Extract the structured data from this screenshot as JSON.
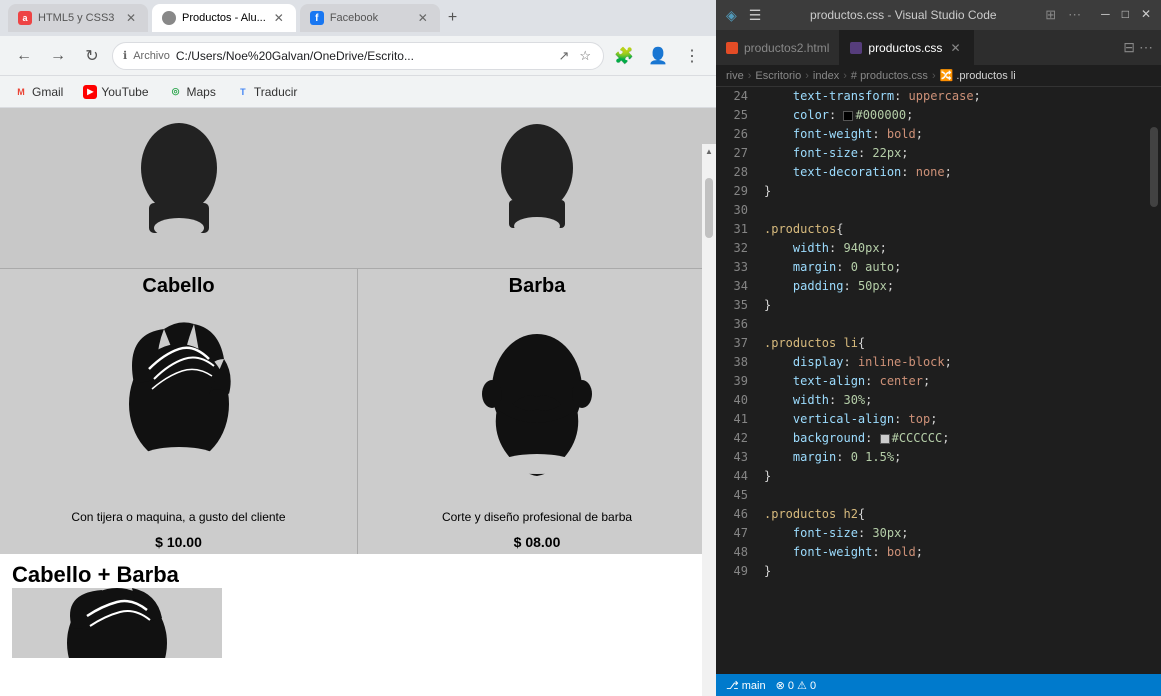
{
  "browser": {
    "tabs": [
      {
        "id": "tab-html5",
        "label": "HTML5 y CSS3",
        "icon_type": "a",
        "active": false
      },
      {
        "id": "tab-productos",
        "label": "Productos - Alu...",
        "icon_type": "prod",
        "active": true
      },
      {
        "id": "tab-facebook",
        "label": "Facebook",
        "icon_type": "fb",
        "active": false
      }
    ],
    "tab_add_label": "+",
    "nav": {
      "back": "←",
      "forward": "→",
      "refresh": "↻",
      "home": "⌂"
    },
    "address": {
      "protocol": "Archivo",
      "path": "C:/Users/Noe%20Galvan/OneDrive/Escrito..."
    },
    "address_icons": [
      "⭐",
      "🧩",
      "⊕"
    ],
    "bookmarks": [
      {
        "id": "gmail",
        "label": "Gmail",
        "icon": "M"
      },
      {
        "id": "youtube",
        "label": "YouTube",
        "icon": "▶"
      },
      {
        "id": "maps",
        "label": "Maps",
        "icon": "◉"
      },
      {
        "id": "traducir",
        "label": "Traducir",
        "icon": "T"
      }
    ]
  },
  "products_page": {
    "top_images": {
      "left": "silhouette_head_1",
      "right": "silhouette_head_2"
    },
    "products": [
      {
        "id": "cabello",
        "title": "Cabello",
        "description": "Con tijera o maquina, a gusto del cliente",
        "price": "$ 10.00"
      },
      {
        "id": "barba",
        "title": "Barba",
        "description": "Corte y diseño profesional de barba",
        "price": "$ 08.00"
      }
    ],
    "combo_title": "Cabello + Barba"
  },
  "vscode": {
    "titlebar": {
      "menu_icon": "☰",
      "split_icon": "⊞",
      "more_icon": "⋯",
      "title": "productos.css - Visual Studio Code",
      "btn_minimize": "─",
      "btn_maximize": "□",
      "btn_close": "✕"
    },
    "tabs": [
      {
        "id": "productos2-html",
        "label": "productos2.html",
        "icon_type": "html",
        "active": false
      },
      {
        "id": "productos-css",
        "label": "productos.css",
        "icon_type": "css",
        "active": true
      }
    ],
    "breadcrumb": {
      "parts": [
        "rive",
        "Escritorio",
        "index",
        "#  productos.css",
        "🔀 .productos li"
      ]
    },
    "lines": [
      {
        "num": 24,
        "content": "    text-transform: uppercase;",
        "tokens": [
          {
            "text": "    ",
            "cls": ""
          },
          {
            "text": "text-transform",
            "cls": "property"
          },
          {
            "text": ": ",
            "cls": "punctuation"
          },
          {
            "text": "uppercase",
            "cls": "value"
          },
          {
            "text": ";",
            "cls": "punctuation"
          }
        ]
      },
      {
        "num": 25,
        "content": "    color: □#000000;",
        "tokens": [
          {
            "text": "    ",
            "cls": ""
          },
          {
            "text": "color",
            "cls": "property"
          },
          {
            "text": ": ",
            "cls": "punctuation"
          },
          {
            "text": "COLOR#000000",
            "cls": "value-color"
          },
          {
            "text": ";",
            "cls": "punctuation"
          }
        ]
      },
      {
        "num": 26,
        "content": "    font-weight: bold;",
        "tokens": [
          {
            "text": "    ",
            "cls": ""
          },
          {
            "text": "font-weight",
            "cls": "property"
          },
          {
            "text": ": ",
            "cls": "punctuation"
          },
          {
            "text": "bold",
            "cls": "value"
          },
          {
            "text": ";",
            "cls": "punctuation"
          }
        ]
      },
      {
        "num": 27,
        "content": "    font-size: 22px;",
        "tokens": [
          {
            "text": "    ",
            "cls": ""
          },
          {
            "text": "font-size",
            "cls": "property"
          },
          {
            "text": ": ",
            "cls": "punctuation"
          },
          {
            "text": "22px",
            "cls": "value-num"
          },
          {
            "text": ";",
            "cls": "punctuation"
          }
        ]
      },
      {
        "num": 28,
        "content": "    text-decoration: none;",
        "tokens": [
          {
            "text": "    ",
            "cls": ""
          },
          {
            "text": "text-decoration",
            "cls": "property"
          },
          {
            "text": ": ",
            "cls": "punctuation"
          },
          {
            "text": "none",
            "cls": "value"
          },
          {
            "text": ";",
            "cls": "punctuation"
          }
        ]
      },
      {
        "num": 29,
        "content": "}",
        "tokens": [
          {
            "text": "}",
            "cls": "punctuation"
          }
        ]
      },
      {
        "num": 30,
        "content": "",
        "tokens": []
      },
      {
        "num": 31,
        "content": ".productos{",
        "tokens": [
          {
            "text": ".productos",
            "cls": "selector"
          },
          {
            "text": "{",
            "cls": "punctuation"
          }
        ]
      },
      {
        "num": 32,
        "content": "    width: 940px;",
        "tokens": [
          {
            "text": "    ",
            "cls": ""
          },
          {
            "text": "width",
            "cls": "property"
          },
          {
            "text": ": ",
            "cls": "punctuation"
          },
          {
            "text": "940px",
            "cls": "value-num"
          },
          {
            "text": ";",
            "cls": "punctuation"
          }
        ]
      },
      {
        "num": 33,
        "content": "    margin: 0 auto;",
        "tokens": [
          {
            "text": "    ",
            "cls": ""
          },
          {
            "text": "margin",
            "cls": "property"
          },
          {
            "text": ": ",
            "cls": "punctuation"
          },
          {
            "text": "0 auto",
            "cls": "value-num"
          },
          {
            "text": ";",
            "cls": "punctuation"
          }
        ]
      },
      {
        "num": 34,
        "content": "    padding: 50px;",
        "tokens": [
          {
            "text": "    ",
            "cls": ""
          },
          {
            "text": "padding",
            "cls": "property"
          },
          {
            "text": ": ",
            "cls": "punctuation"
          },
          {
            "text": "50px",
            "cls": "value-num"
          },
          {
            "text": ";",
            "cls": "punctuation"
          }
        ]
      },
      {
        "num": 35,
        "content": "}",
        "tokens": [
          {
            "text": "}",
            "cls": "punctuation"
          }
        ]
      },
      {
        "num": 36,
        "content": "",
        "tokens": []
      },
      {
        "num": 37,
        "content": ".productos li{",
        "tokens": [
          {
            "text": ".productos li",
            "cls": "selector"
          },
          {
            "text": "{",
            "cls": "punctuation"
          }
        ]
      },
      {
        "num": 38,
        "content": "    display: inline-block;",
        "tokens": [
          {
            "text": "    ",
            "cls": ""
          },
          {
            "text": "display",
            "cls": "property"
          },
          {
            "text": ": ",
            "cls": "punctuation"
          },
          {
            "text": "inline-block",
            "cls": "value"
          },
          {
            "text": ";",
            "cls": "punctuation"
          }
        ]
      },
      {
        "num": 39,
        "content": "    text-align: center;",
        "tokens": [
          {
            "text": "    ",
            "cls": ""
          },
          {
            "text": "text-align",
            "cls": "property"
          },
          {
            "text": ": ",
            "cls": "punctuation"
          },
          {
            "text": "center",
            "cls": "value"
          },
          {
            "text": ";",
            "cls": "punctuation"
          }
        ]
      },
      {
        "num": 40,
        "content": "    width: 30%;",
        "tokens": [
          {
            "text": "    ",
            "cls": ""
          },
          {
            "text": "width",
            "cls": "property"
          },
          {
            "text": ": ",
            "cls": "punctuation"
          },
          {
            "text": "30%",
            "cls": "value-num"
          },
          {
            "text": ";",
            "cls": "punctuation"
          }
        ]
      },
      {
        "num": 41,
        "content": "    vertical-align: top;",
        "tokens": [
          {
            "text": "    ",
            "cls": ""
          },
          {
            "text": "vertical-align",
            "cls": "property"
          },
          {
            "text": ": ",
            "cls": "punctuation"
          },
          {
            "text": "top",
            "cls": "value"
          },
          {
            "text": ";",
            "cls": "punctuation"
          }
        ]
      },
      {
        "num": 42,
        "content": "    background: □#CCCCCC;",
        "tokens": [
          {
            "text": "    ",
            "cls": ""
          },
          {
            "text": "background",
            "cls": "property"
          },
          {
            "text": ": ",
            "cls": "punctuation"
          },
          {
            "text": "COLOR#CCCCCC",
            "cls": "value-color"
          },
          {
            "text": ";",
            "cls": "punctuation"
          }
        ]
      },
      {
        "num": 43,
        "content": "    margin: 0 1.5%;",
        "tokens": [
          {
            "text": "    ",
            "cls": ""
          },
          {
            "text": "margin",
            "cls": "property"
          },
          {
            "text": ": ",
            "cls": "punctuation"
          },
          {
            "text": "0 1.5%",
            "cls": "value-num"
          },
          {
            "text": ";",
            "cls": "punctuation"
          }
        ]
      },
      {
        "num": 44,
        "content": "}",
        "tokens": [
          {
            "text": "}",
            "cls": "punctuation"
          }
        ]
      },
      {
        "num": 45,
        "content": "",
        "tokens": []
      },
      {
        "num": 46,
        "content": ".productos h2{",
        "tokens": [
          {
            "text": ".productos h2",
            "cls": "selector"
          },
          {
            "text": "{",
            "cls": "punctuation"
          }
        ]
      },
      {
        "num": 47,
        "content": "    font-size: 30px;",
        "tokens": [
          {
            "text": "    ",
            "cls": ""
          },
          {
            "text": "font-size",
            "cls": "property"
          },
          {
            "text": ": ",
            "cls": "punctuation"
          },
          {
            "text": "30px",
            "cls": "value-num"
          },
          {
            "text": ";",
            "cls": "punctuation"
          }
        ]
      },
      {
        "num": 48,
        "content": "    font-weight: bold;",
        "tokens": [
          {
            "text": "    ",
            "cls": ""
          },
          {
            "text": "font-weight",
            "cls": "property"
          },
          {
            "text": ": ",
            "cls": "punctuation"
          },
          {
            "text": "bold",
            "cls": "value"
          },
          {
            "text": ";",
            "cls": "punctuation"
          }
        ]
      },
      {
        "num": 49,
        "content": "}",
        "tokens": [
          {
            "text": "}",
            "cls": "punctuation"
          }
        ]
      }
    ]
  }
}
